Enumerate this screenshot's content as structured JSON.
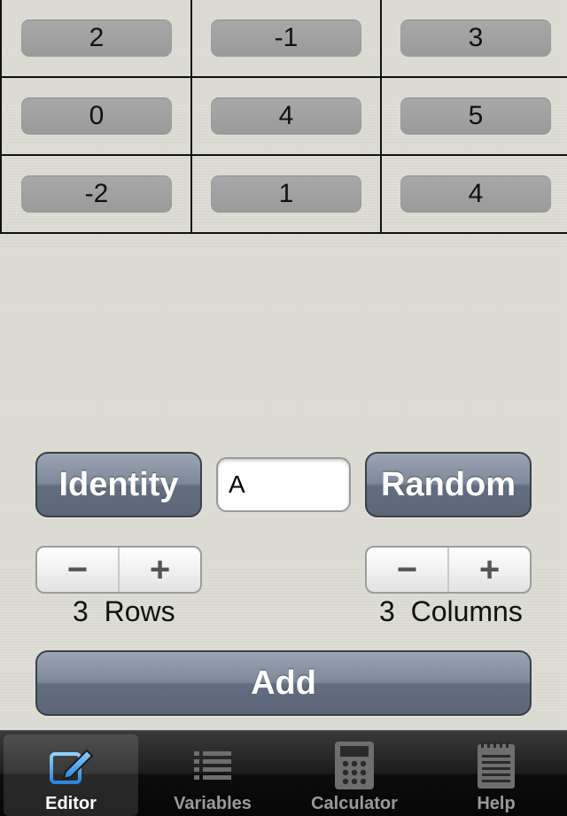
{
  "matrix": {
    "rows": [
      [
        "2",
        "-1",
        "3"
      ],
      [
        "0",
        "4",
        "5"
      ],
      [
        "-2",
        "1",
        "4"
      ]
    ]
  },
  "controls": {
    "identity_label": "Identity",
    "random_label": "Random",
    "name_value": "A",
    "add_label": "Add",
    "rows_stepper": {
      "minus": "−",
      "plus": "+",
      "count": "3",
      "unit": "Rows"
    },
    "cols_stepper": {
      "minus": "−",
      "plus": "+",
      "count": "3",
      "unit": "Columns"
    }
  },
  "tabbar": {
    "tabs": [
      {
        "label": "Editor",
        "icon": "pencil-edit-icon",
        "active": true
      },
      {
        "label": "Variables",
        "icon": "list-icon",
        "active": false
      },
      {
        "label": "Calculator",
        "icon": "calculator-icon",
        "active": false
      },
      {
        "label": "Help",
        "icon": "notepad-icon",
        "active": false
      }
    ]
  },
  "colors": {
    "button_dark": "#626d80",
    "cell_fill": "#a0a0a0",
    "background": "#dcdbd4",
    "tab_active_icon": "#4aa3f0"
  }
}
